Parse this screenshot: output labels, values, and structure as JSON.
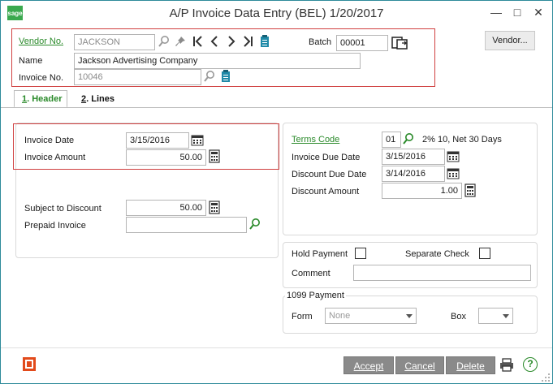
{
  "window": {
    "title": "A/P Invoice Data Entry (BEL) 1/20/2017",
    "logo_text": "sage",
    "minimize_glyph": "—",
    "maximize_glyph": "□",
    "close_glyph": "✕"
  },
  "header": {
    "vendor_no_label": "Vendor No.",
    "vendor_no_value": "JACKSON",
    "name_label": "Name",
    "name_value": "Jackson Advertising Company",
    "invoice_no_label": "Invoice No.",
    "invoice_no_value": "10046",
    "batch_label": "Batch",
    "batch_value": "00001",
    "vendor_button": "Vendor..."
  },
  "tabs": [
    {
      "num": "1",
      "label": ". Header"
    },
    {
      "num": "2",
      "label": ". Lines"
    }
  ],
  "invoice": {
    "date_label": "Invoice Date",
    "date_value": "3/15/2016",
    "amount_label": "Invoice Amount",
    "amount_value": "50.00",
    "subject_label": "Subject to Discount",
    "subject_value": "50.00",
    "prepaid_label": "Prepaid Invoice",
    "prepaid_value": ""
  },
  "terms": {
    "code_label": "Terms Code",
    "code_value": "01",
    "code_desc": "2% 10, Net 30 Days",
    "due_label": "Invoice Due Date",
    "due_value": "3/15/2016",
    "disc_due_label": "Discount Due Date",
    "disc_due_value": "3/14/2016",
    "disc_amt_label": "Discount Amount",
    "disc_amt_value": "1.00"
  },
  "payment": {
    "hold_label": "Hold Payment",
    "separate_label": "Separate Check",
    "comment_label": "Comment",
    "comment_value": ""
  },
  "p1099": {
    "group_label": "1099 Payment",
    "form_label": "Form",
    "form_value": "None",
    "box_label": "Box",
    "box_value": ""
  },
  "footer": {
    "accept": "Accept",
    "cancel": "Cancel",
    "delete": "Delete",
    "help_glyph": "?"
  },
  "colors": {
    "accent_green": "#2a8a2a",
    "highlight_red": "#d04040",
    "button_gray": "#8a8a8a",
    "office_orange": "#e24a1b"
  }
}
